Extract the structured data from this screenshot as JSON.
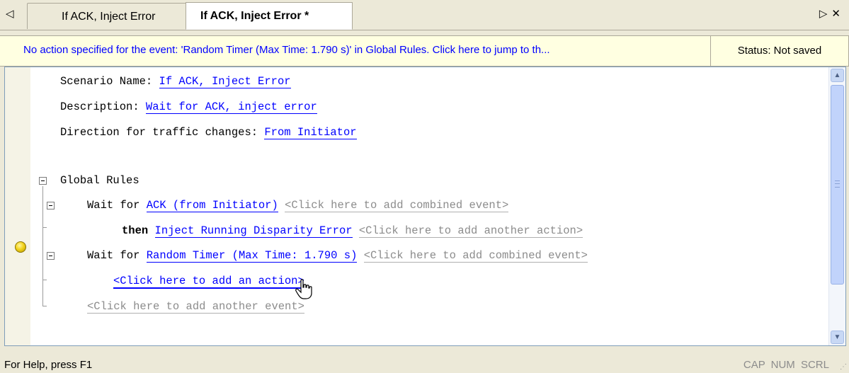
{
  "tabs": {
    "scroll_left_icon": "◁",
    "items": [
      {
        "label": "If ACK, Inject Error"
      },
      {
        "label": "If ACK, Inject Error *"
      }
    ],
    "right_icons": "▷✕"
  },
  "info_bar": {
    "message": "No action specified for the event: 'Random Timer (Max Time: 1.790 s)' in Global Rules.  Click here to jump to th...",
    "status": "Status: Not saved"
  },
  "editor": {
    "scenario_name_label": "Scenario Name: ",
    "scenario_name_value": "If ACK, Inject Error",
    "description_label": "Description: ",
    "description_value": "Wait for ACK, inject error",
    "direction_label": "Direction for traffic changes: ",
    "direction_value": "From Initiator",
    "global_rules_label": "Global Rules",
    "rule1_prefix": "Wait for ",
    "rule1_event": "ACK (from Initiator)",
    "rule1_add_combined": "<Click here to add combined event>",
    "rule1_then": "then ",
    "rule1_action": "Inject Running Disparity Error",
    "rule1_add_action": "<Click here to add another action>",
    "rule2_prefix": "Wait for ",
    "rule2_event": "Random Timer (Max Time: 1.790 s)",
    "rule2_add_combined": "<Click here to add combined event>",
    "rule2_add_action": "<Click here to add an action>",
    "add_another_event": "<Click here to add another event>"
  },
  "status_bar": {
    "help": "For Help, press F1",
    "indicators": "CAP NUM SCRL"
  }
}
